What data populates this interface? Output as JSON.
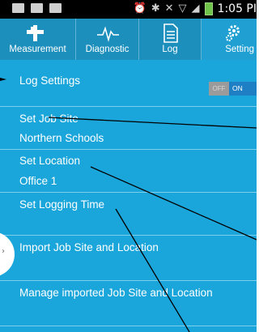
{
  "status_bar": {
    "time": "1:05 PI",
    "icons": [
      "message-icon",
      "image-icon",
      "mail-icon",
      "alarm-icon",
      "bluetooth-icon",
      "mute-icon",
      "wifi-icon",
      "signal-icon",
      "battery-icon"
    ]
  },
  "tabs": [
    {
      "label": "Measurement",
      "icon": "measurement-icon",
      "active": false
    },
    {
      "label": "Diagnostic",
      "icon": "pulse-icon",
      "active": false
    },
    {
      "label": "Log",
      "icon": "document-icon",
      "active": false
    },
    {
      "label": "Setting",
      "icon": "gear-icon",
      "active": true
    }
  ],
  "settings": {
    "log_settings": {
      "label": "Log Settings",
      "toggle": {
        "off_label": "OFF",
        "on_label": "ON",
        "value": "ON"
      }
    },
    "job_site": {
      "label": "Set Job Site",
      "value": "Northern Schools"
    },
    "location": {
      "label": "Set Location",
      "value": "Office 1"
    },
    "logging_time": {
      "label": "Set Logging Time"
    },
    "import": {
      "label": "Import Job Site and Location"
    },
    "manage": {
      "label": "Manage imported Job Site and Location"
    }
  },
  "colors": {
    "tab_bar": "#1d8fbd",
    "content_bg": "#1ba6db",
    "divider": "#7cd0ee",
    "toggle_on": "#1e7fc4",
    "toggle_off": "#9b9b9b"
  }
}
